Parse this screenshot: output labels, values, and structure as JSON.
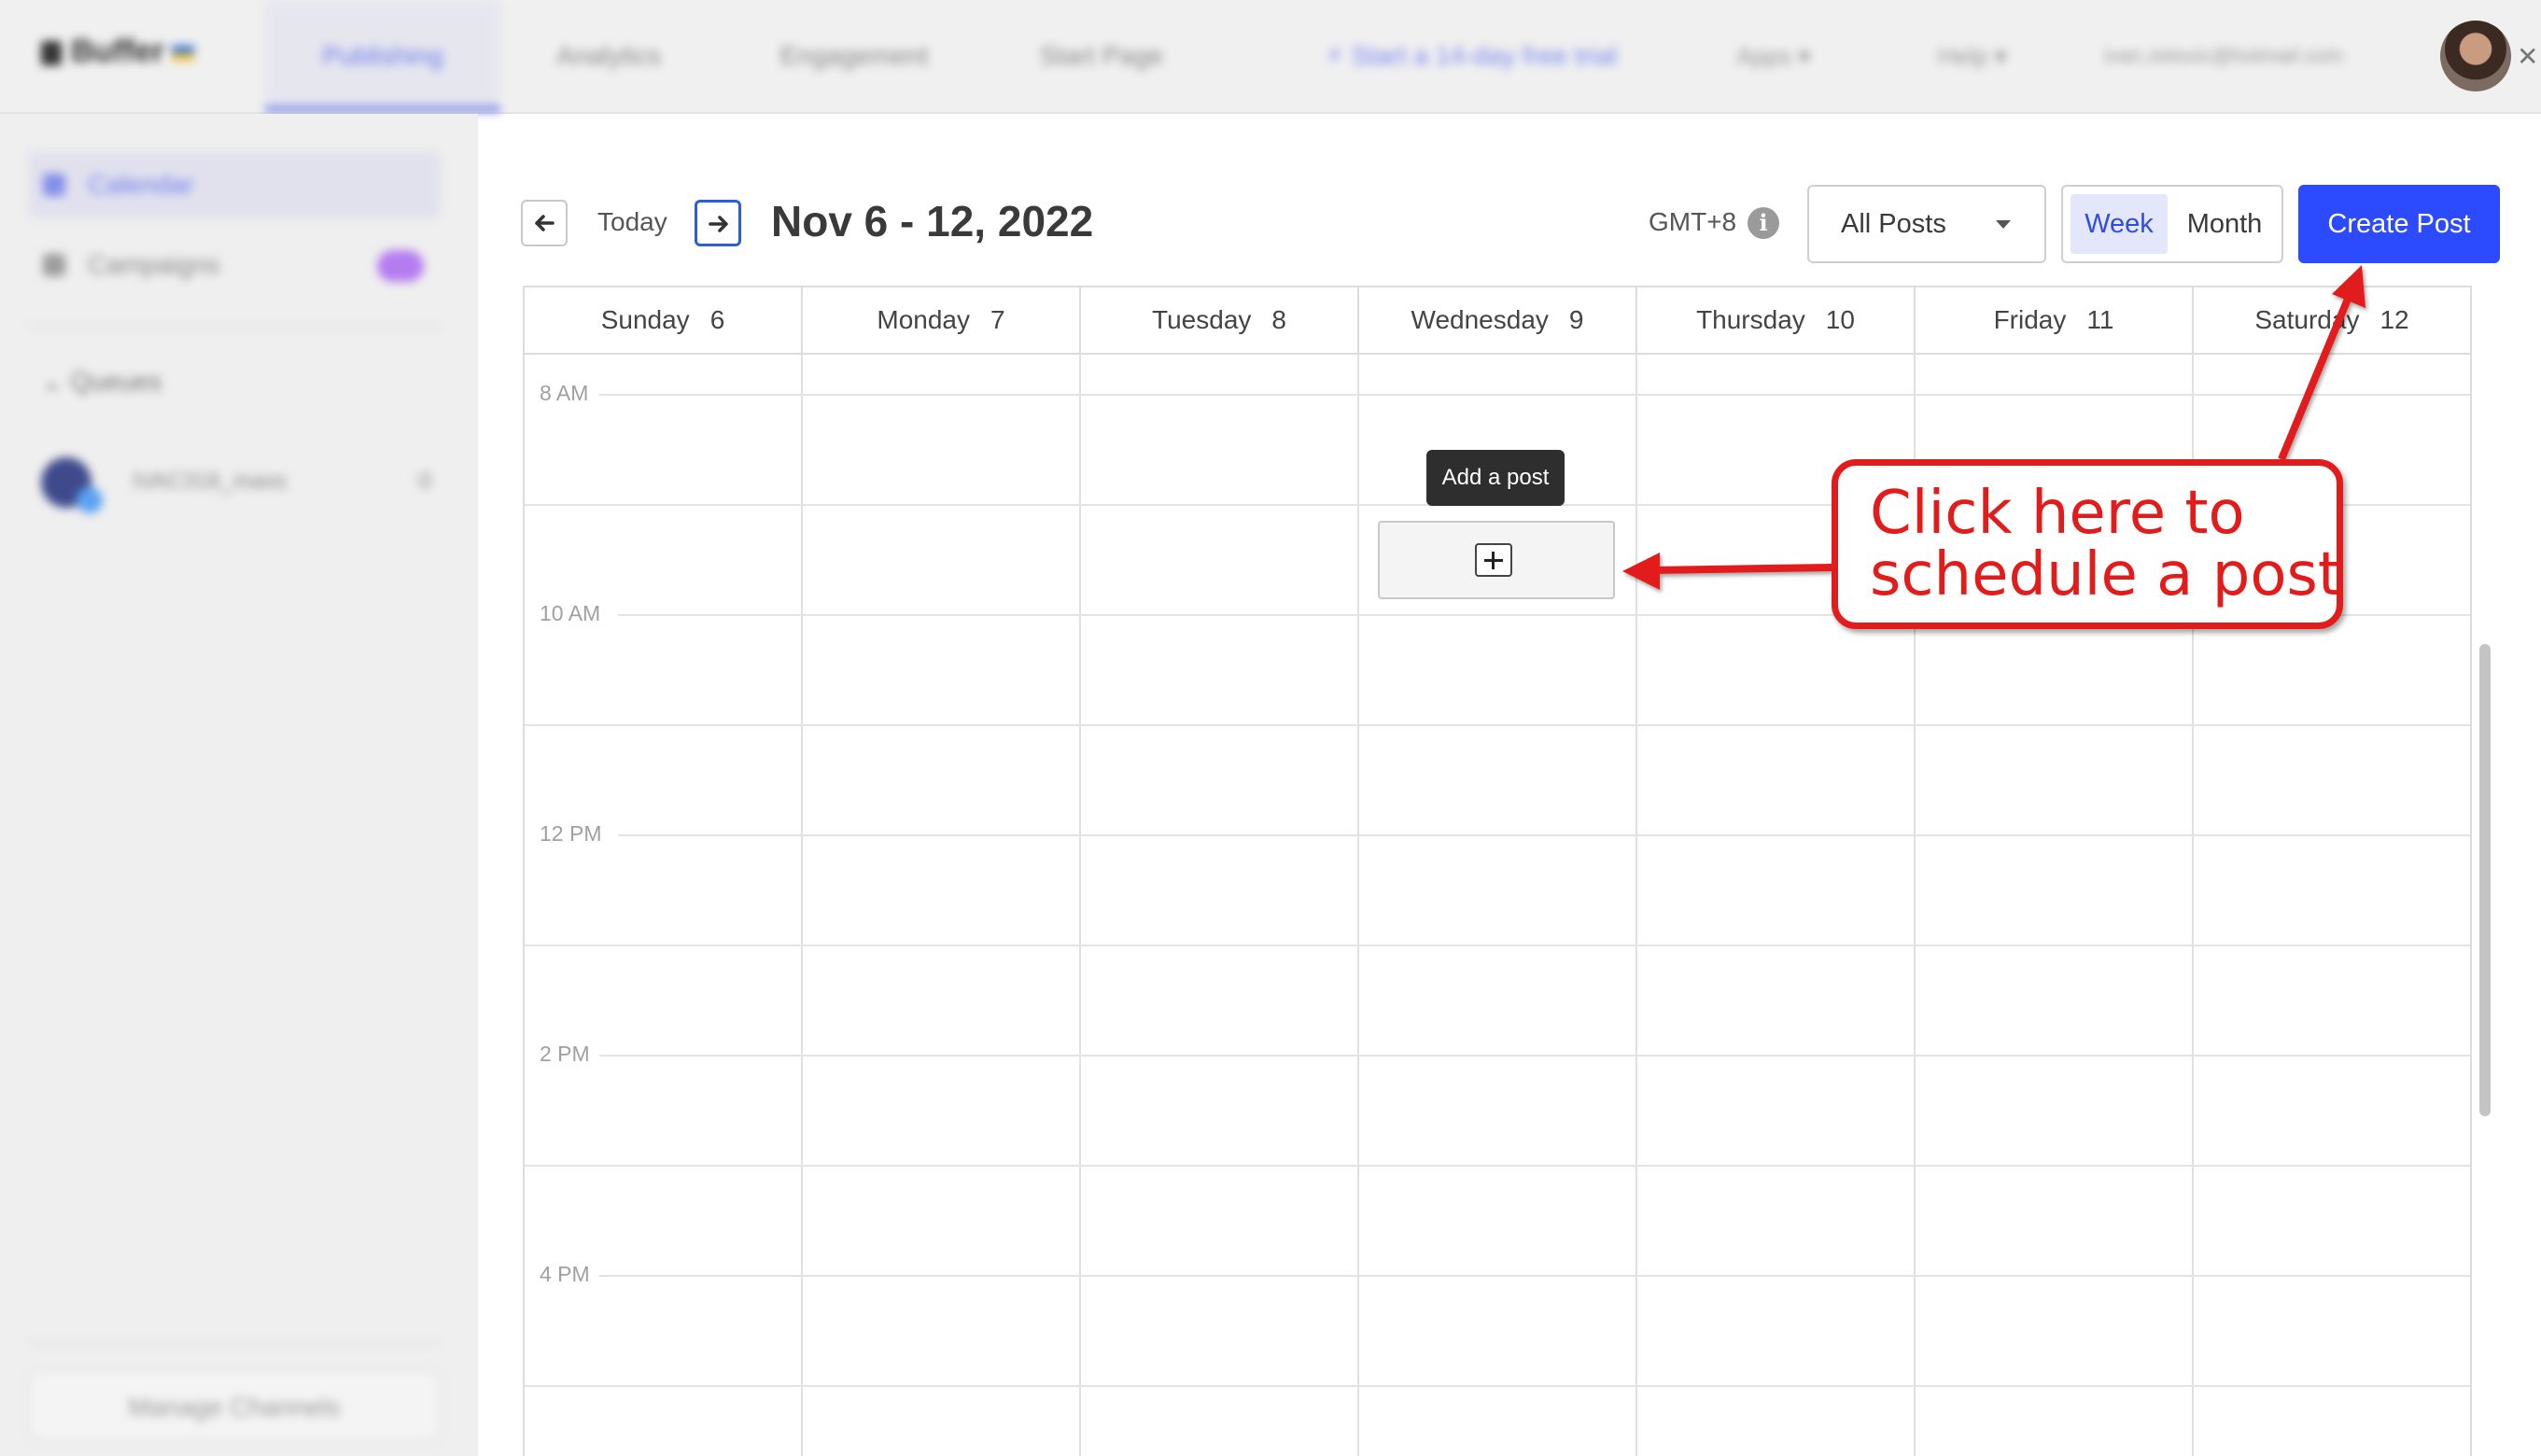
{
  "topnav": {
    "logo": "Buffer",
    "tabs": [
      "Publishing",
      "Analytics",
      "Engagement",
      "Start Page"
    ],
    "active_tab": "Publishing",
    "trial": "Start a 14-day free trial",
    "apps": "Apps",
    "help": "Help",
    "email": "ivan.zetovic@hotmail.com"
  },
  "sidebar": {
    "calendar": "Calendar",
    "campaigns": "Campaigns",
    "queues": "Queues",
    "channel_name": "IVAC316_mass",
    "channel_count": "0",
    "manage": "Manage Channels"
  },
  "calendar": {
    "today": "Today",
    "range": "Nov 6 - 12, 2022",
    "timezone": "GMT+8",
    "filter": "All Posts",
    "view_week": "Week",
    "view_month": "Month",
    "create_post": "Create Post",
    "days": [
      {
        "name": "Sunday",
        "num": "6"
      },
      {
        "name": "Monday",
        "num": "7"
      },
      {
        "name": "Tuesday",
        "num": "8"
      },
      {
        "name": "Wednesday",
        "num": "9"
      },
      {
        "name": "Thursday",
        "num": "10"
      },
      {
        "name": "Friday",
        "num": "11"
      },
      {
        "name": "Saturday",
        "num": "12"
      }
    ],
    "hours": [
      "8 AM",
      "10 AM",
      "12 PM",
      "2 PM",
      "4 PM"
    ],
    "tooltip": "Add a post"
  },
  "annotation": {
    "line1": "Click here to",
    "line2": "schedule a post",
    "color": "#e21b1b"
  },
  "colors": {
    "accent": "#2c4bff",
    "sidebar_bg": "#efefef"
  }
}
